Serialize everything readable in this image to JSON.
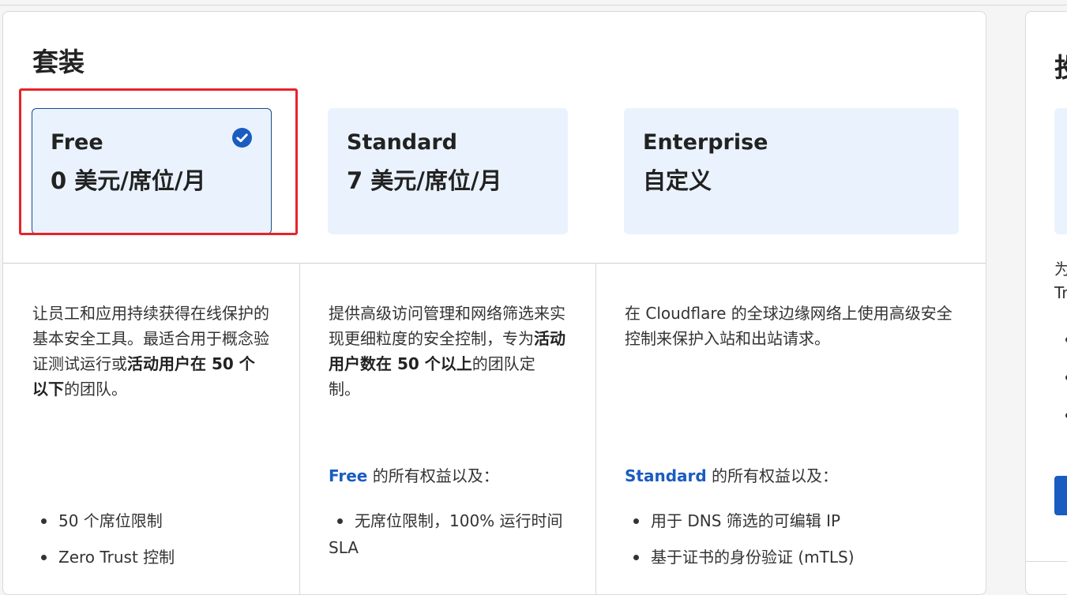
{
  "section_title": "套装",
  "plans": [
    {
      "name": "Free",
      "price": "0 美元/席位/月",
      "selected": true
    },
    {
      "name": "Standard",
      "price": "7 美元/席位/月",
      "selected": false
    },
    {
      "name": "Enterprise",
      "price": "自定义",
      "selected": false
    }
  ],
  "descriptions": {
    "free": {
      "part1": "让员工和应用持续获得在线保护的基本安全工具。最适合用于概念验证测试运行或",
      "bold": "活动用户在 50 个以下",
      "part2": "的团队。"
    },
    "standard": {
      "part1": "提供高级访问管理和网络筛选来实现更细粒度的安全控制，专为",
      "bold": "活动用户数在 50 个以上",
      "part2": "的团队定制。"
    },
    "enterprise": {
      "part1": "在 Cloudflare 的全球边缘网络上使用高级安全控制来保护入站和出站请求。"
    }
  },
  "perks_headers": {
    "standard": {
      "link": "Free",
      "text": " 的所有权益以及："
    },
    "enterprise": {
      "link": "Standard",
      "text": " 的所有权益以及："
    }
  },
  "features": {
    "free": [
      "50 个席位限制",
      "Zero Trust 控制"
    ],
    "standard": [
      "无席位限制，100% 运行时间 SLA"
    ],
    "enterprise": [
      "用于 DNS 筛选的可编辑 IP",
      "基于证书的身份验证 (mTLS)"
    ]
  },
  "second_card": {
    "heading_partial": "投",
    "text_line1": "为",
    "text_line2": "Tr"
  },
  "colors": {
    "accent": "#1a5cc0",
    "selected_border": "#1a4a8a",
    "plan_bg": "#eaf3fd",
    "highlight": "#e8232a"
  }
}
